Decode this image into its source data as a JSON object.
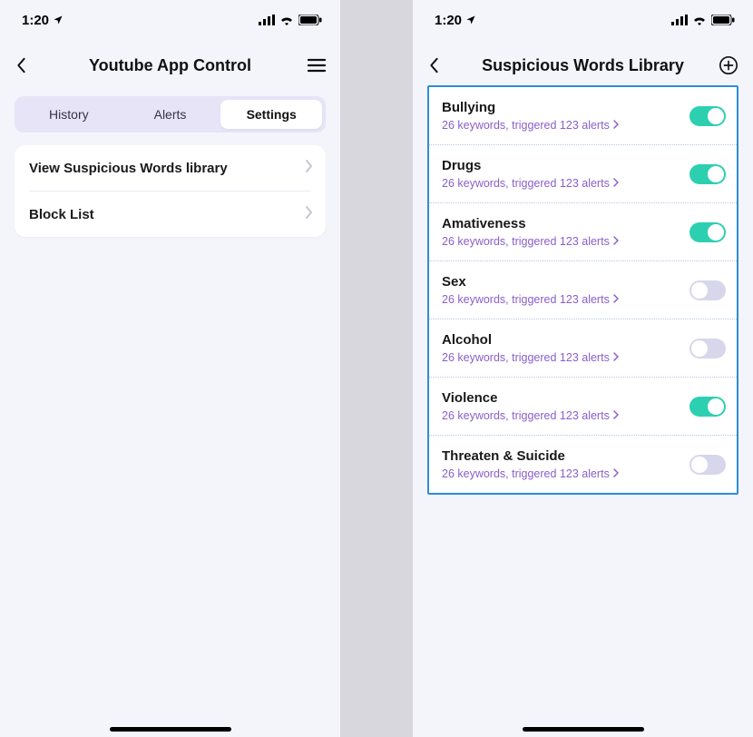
{
  "status": {
    "time": "1:20",
    "location_icon": "location-arrow",
    "signal_icon": "cellular",
    "wifi_icon": "wifi",
    "battery_icon": "battery-full"
  },
  "left": {
    "title": "Youtube App Control",
    "back_icon": "chevron-left",
    "menu_icon": "menu",
    "tabs": {
      "history": "History",
      "alerts": "Alerts",
      "settings": "Settings",
      "active": "settings"
    },
    "settings": {
      "rows": [
        {
          "label": "View Suspicious Words library"
        },
        {
          "label": "Block List"
        }
      ]
    }
  },
  "right": {
    "title": "Suspicious  Words Library",
    "back_icon": "chevron-left",
    "add_icon": "plus-circle",
    "categories": [
      {
        "title": "Bullying",
        "sub": "26 keywords, triggered 123 alerts",
        "enabled": true
      },
      {
        "title": "Drugs",
        "sub": "26 keywords, triggered 123 alerts",
        "enabled": true
      },
      {
        "title": "Amativeness",
        "sub": "26 keywords, triggered 123 alerts",
        "enabled": true
      },
      {
        "title": "Sex",
        "sub": "26 keywords, triggered 123 alerts",
        "enabled": false
      },
      {
        "title": "Alcohol",
        "sub": "26 keywords, triggered 123 alerts",
        "enabled": false
      },
      {
        "title": "Violence",
        "sub": "26 keywords, triggered 123 alerts",
        "enabled": true
      },
      {
        "title": "Threaten & Suicide",
        "sub": "26 keywords, triggered 123 alerts",
        "enabled": false
      }
    ]
  },
  "colors": {
    "accent_toggle_on": "#2cd0b0",
    "accent_border": "#2c8ed6",
    "sub_text": "#8a5fc9"
  }
}
